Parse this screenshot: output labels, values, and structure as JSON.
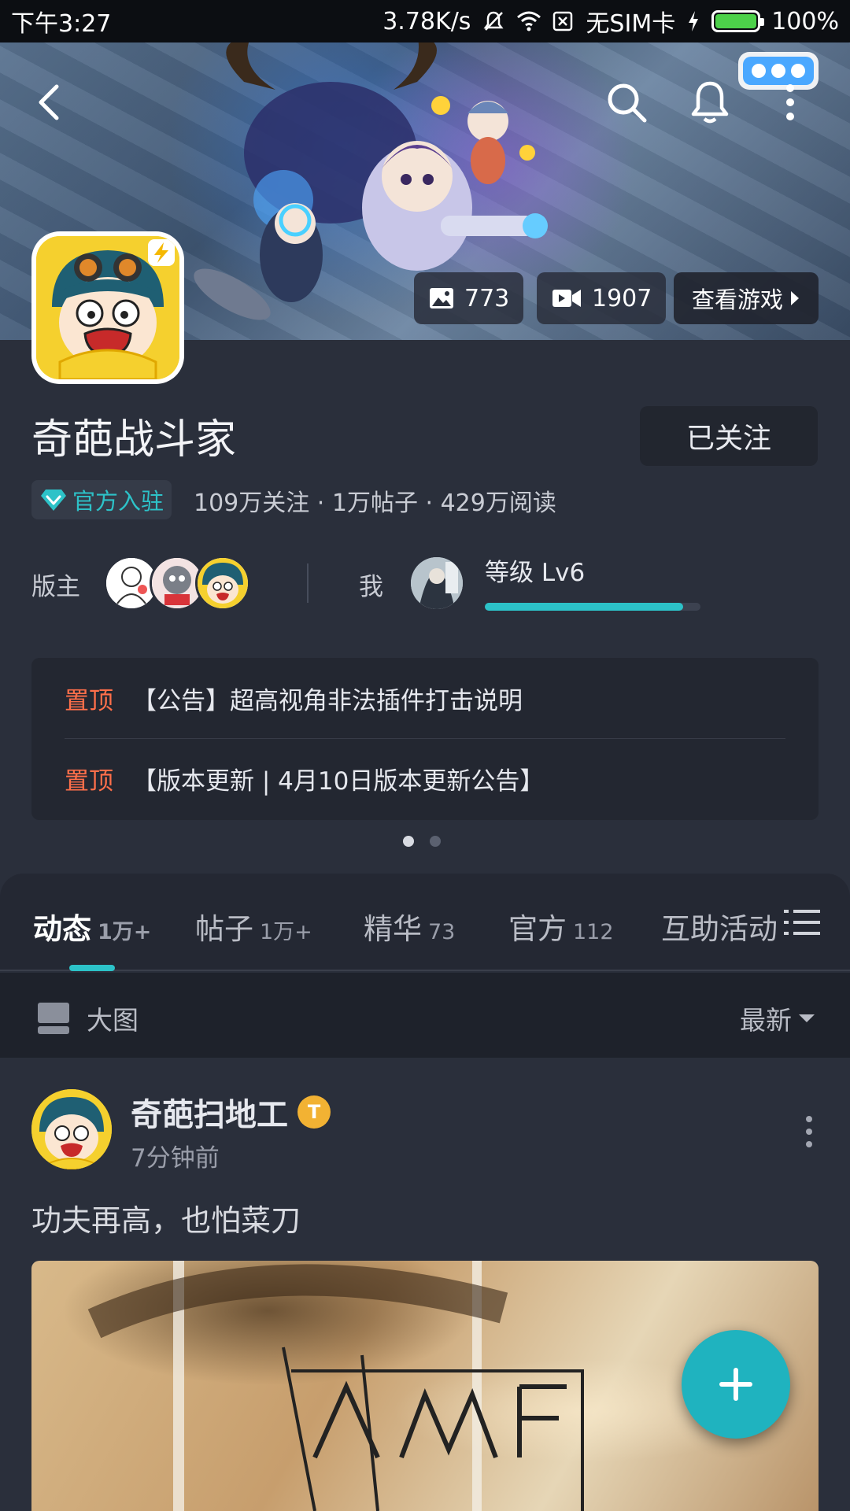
{
  "status_bar": {
    "time": "下午3:27",
    "network_speed": "3.78K/s",
    "sim": "无SIM卡",
    "battery_level": 1.0,
    "battery": "100%",
    "icons": [
      "mute-icon",
      "wifi-icon",
      "no-sim-icon",
      "charging-icon",
      "battery-icon"
    ]
  },
  "banner": {
    "nav_icons": [
      "back-icon",
      "search-icon",
      "bell-icon",
      "more-icon"
    ],
    "images_count": "773",
    "videos_count": "1907",
    "view_game_label": "查看游戏"
  },
  "forum": {
    "title": "奇葩战斗家",
    "follow_label": "已关注",
    "official_label": "官方入驻",
    "stats": "109万关注 · 1万帖子 · 429万阅读",
    "moderators_label": "版主",
    "me_label": "我",
    "level_text": "等级 Lv6",
    "level_progress": 0.92
  },
  "notices": [
    {
      "tag": "置顶",
      "text": "【公告】超高视角非法插件打击说明"
    },
    {
      "tag": "置顶",
      "text": "【版本更新 | 4月10日版本更新公告】"
    }
  ],
  "tabs": [
    {
      "label": "动态",
      "count": "1万+"
    },
    {
      "label": "帖子",
      "count": "1万+"
    },
    {
      "label": "精华",
      "count": "73"
    },
    {
      "label": "官方",
      "count": "112"
    },
    {
      "label": "互助活动",
      "count": ""
    }
  ],
  "filter": {
    "view_mode_label": "大图",
    "sort_label": "最新"
  },
  "post": {
    "author": "奇葩扫地工",
    "badge": "T",
    "time": "7分钟前",
    "text": "功夫再高，也怕菜刀"
  },
  "colors": {
    "accent": "#2cc2c8",
    "pin_tag": "#ff6f4a",
    "background": "#2a2f3b",
    "fab": "#1fb3bf"
  }
}
